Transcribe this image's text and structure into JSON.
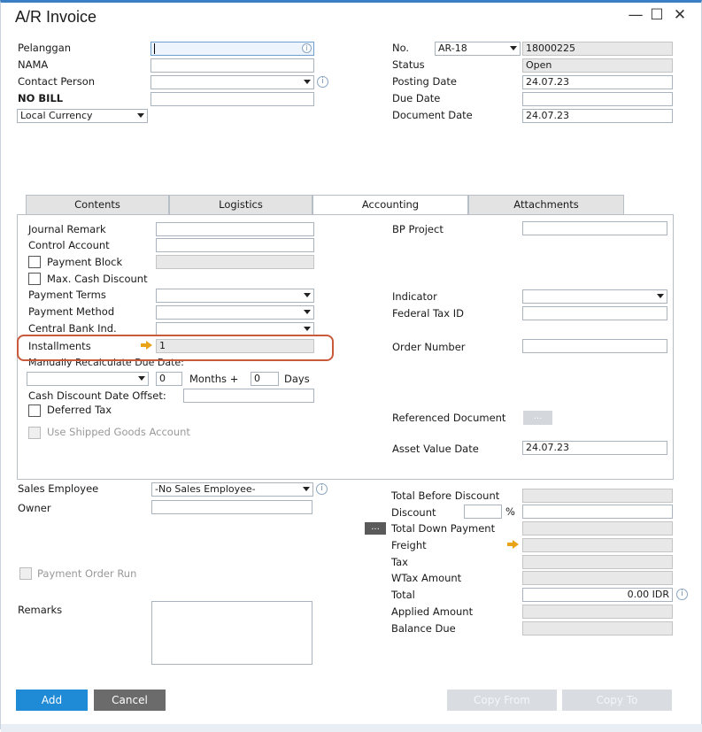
{
  "window": {
    "title": "A/R Invoice"
  },
  "header_left": {
    "customer_label": "Pelanggan",
    "name_label": "NAMA",
    "contact_label": "Contact Person",
    "bill_label": "NO BILL",
    "currency_value": "Local Currency"
  },
  "header_right": {
    "no_label": "No.",
    "series_value": "AR-18",
    "doc_number": "18000225",
    "status_label": "Status",
    "status_value": "Open",
    "posting_label": "Posting Date",
    "posting_value": "24.07.23",
    "due_label": "Due Date",
    "due_value": "",
    "docdate_label": "Document Date",
    "docdate_value": "24.07.23"
  },
  "tabs": [
    {
      "label": "Contents"
    },
    {
      "label": "Logistics"
    },
    {
      "label": "Accounting"
    },
    {
      "label": "Attachments"
    }
  ],
  "accounting": {
    "journal_remark_label": "Journal Remark",
    "control_account_label": "Control Account",
    "payment_block_label": "Payment Block",
    "max_cash_discount_label": "Max. Cash Discount",
    "payment_terms_label": "Payment Terms",
    "payment_method_label": "Payment Method",
    "central_bank_label": "Central Bank Ind.",
    "installments_label": "Installments",
    "installments_value": "1",
    "manual_recalc_label": "Manually Recalculate Due Date:",
    "months_value": "0",
    "months_label": "Months +",
    "days_value": "0",
    "days_label": "Days",
    "cash_discount_offset_label": "Cash Discount Date Offset:",
    "deferred_tax_label": "Deferred Tax",
    "shipped_goods_label": "Use Shipped Goods Account",
    "bp_project_label": "BP Project",
    "indicator_label": "Indicator",
    "federal_tax_label": "Federal Tax ID",
    "order_number_label": "Order Number",
    "referenced_doc_label": "Referenced Document",
    "asset_value_label": "Asset Value Date",
    "asset_value_value": "24.07.23"
  },
  "footer_left": {
    "sales_employee_label": "Sales Employee",
    "sales_employee_value": "-No Sales Employee-",
    "owner_label": "Owner",
    "payment_order_label": "Payment Order Run",
    "remarks_label": "Remarks"
  },
  "totals": {
    "before_discount_label": "Total Before Discount",
    "discount_label": "Discount",
    "percent_sign": "%",
    "down_payment_label": "Total Down Payment",
    "freight_label": "Freight",
    "tax_label": "Tax",
    "wtax_label": "WTax Amount",
    "total_label": "Total",
    "total_value": "0.00 IDR",
    "applied_label": "Applied Amount",
    "balance_label": "Balance Due"
  },
  "buttons": {
    "add": "Add",
    "cancel": "Cancel",
    "copy_from": "Copy From",
    "copy_to": "Copy To"
  },
  "glyphs": {
    "dots": "...",
    "info": "i",
    "minimize": "—",
    "maximize": "☐",
    "close": "✕"
  },
  "colors": {
    "primary_button": "#1f8ad6",
    "highlight": "#c95a3b",
    "arrow": "#e8a317"
  }
}
